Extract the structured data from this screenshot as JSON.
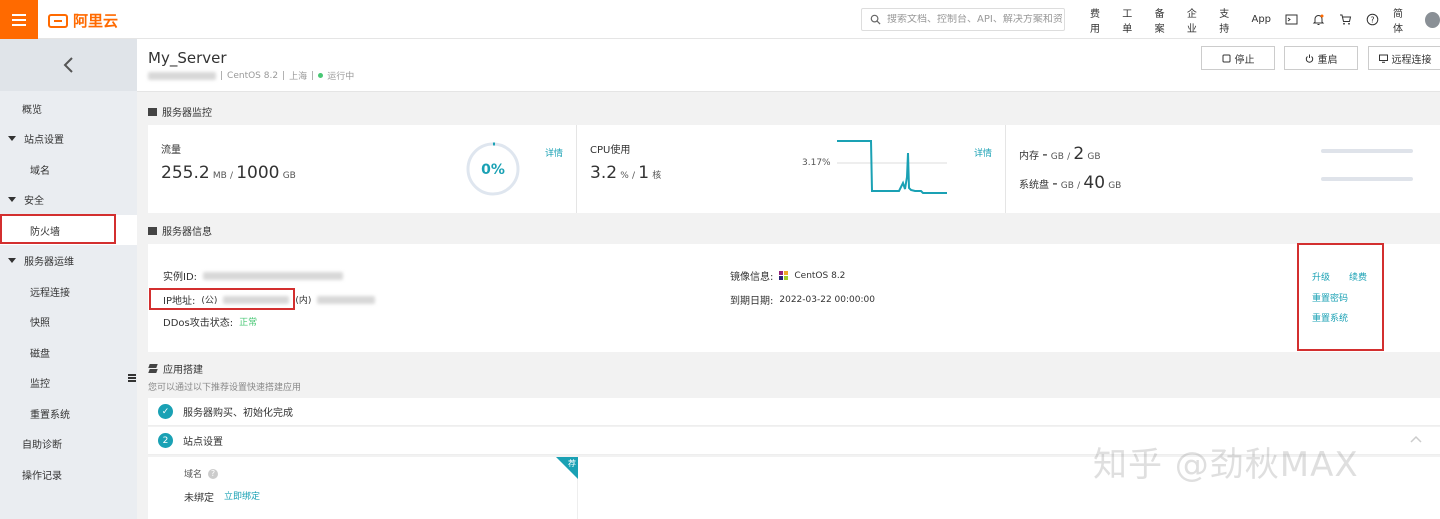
{
  "topbar": {
    "brand": "阿里云",
    "search_placeholder": "搜索文档、控制台、API、解决方案和资源",
    "nav": [
      "费用",
      "工单",
      "备案",
      "企业",
      "支持",
      "App",
      "简体"
    ],
    "icons": [
      "terminal-icon",
      "bell-icon",
      "cart-icon",
      "help-icon"
    ]
  },
  "sidebar": {
    "items": [
      {
        "label": "概览",
        "type": "top"
      },
      {
        "label": "站点设置",
        "type": "group"
      },
      {
        "label": "域名",
        "type": "sub"
      },
      {
        "label": "安全",
        "type": "group"
      },
      {
        "label": "防火墙",
        "type": "sub",
        "active": true
      },
      {
        "label": "服务器运维",
        "type": "group"
      },
      {
        "label": "远程连接",
        "type": "sub"
      },
      {
        "label": "快照",
        "type": "sub"
      },
      {
        "label": "磁盘",
        "type": "sub"
      },
      {
        "label": "监控",
        "type": "sub"
      },
      {
        "label": "重置系统",
        "type": "sub"
      },
      {
        "label": "自助诊断",
        "type": "top"
      },
      {
        "label": "操作记录",
        "type": "top"
      }
    ]
  },
  "header": {
    "name": "My_Server",
    "os": "CentOS 8.2",
    "region": "上海",
    "status": "运行中",
    "buttons": {
      "stop": "停止",
      "restart": "重启",
      "remote": "远程连接"
    }
  },
  "monitor": {
    "title": "服务器监控",
    "traffic": {
      "label": "流量",
      "used": "255.2",
      "used_unit": "MB",
      "total": "1000",
      "total_unit": "GB",
      "percent": "0%",
      "detail": "详情"
    },
    "cpu": {
      "label": "CPU使用",
      "usage": "3.2",
      "usage_unit": "%",
      "cores": "1",
      "cores_unit": "核",
      "peak": "3.17%",
      "detail": "详情"
    },
    "memory": {
      "label": "内存",
      "used": "-",
      "unit": "GB",
      "total": "2",
      "total_unit": "GB"
    },
    "disk": {
      "label": "系统盘",
      "used": "-",
      "unit": "GB",
      "total": "40",
      "total_unit": "GB"
    }
  },
  "info": {
    "title": "服务器信息",
    "instance_id_label": "实例ID:",
    "ip_label": "IP地址:",
    "ip_public": "(公)",
    "ip_private": "(内)",
    "ddos_label": "DDos攻击状态:",
    "ddos_value": "正常",
    "image_label": "镜像信息:",
    "image_value": "CentOS 8.2",
    "expire_label": "到期日期:",
    "expire_value": "2022-03-22 00:00:00",
    "actions": {
      "upgrade": "升级",
      "renew": "续费",
      "reset_password": "重置密码",
      "reset_system": "重置系统"
    }
  },
  "apps": {
    "title": "应用搭建",
    "subtitle": "您可以通过以下推荐设置快速搭建应用",
    "step1": "服务器购买、初始化完成",
    "step2_num": "2",
    "step2": "站点设置",
    "domain_label": "域名",
    "domain_status": "未绑定",
    "bind_link": "立即绑定",
    "badge": "荐"
  },
  "watermark": "知乎 @劲秋MAX",
  "colors": {
    "brand": "#ff6a00",
    "accent": "#1aa1b4",
    "highlight": "#d32f2f",
    "ok": "#48c774"
  }
}
